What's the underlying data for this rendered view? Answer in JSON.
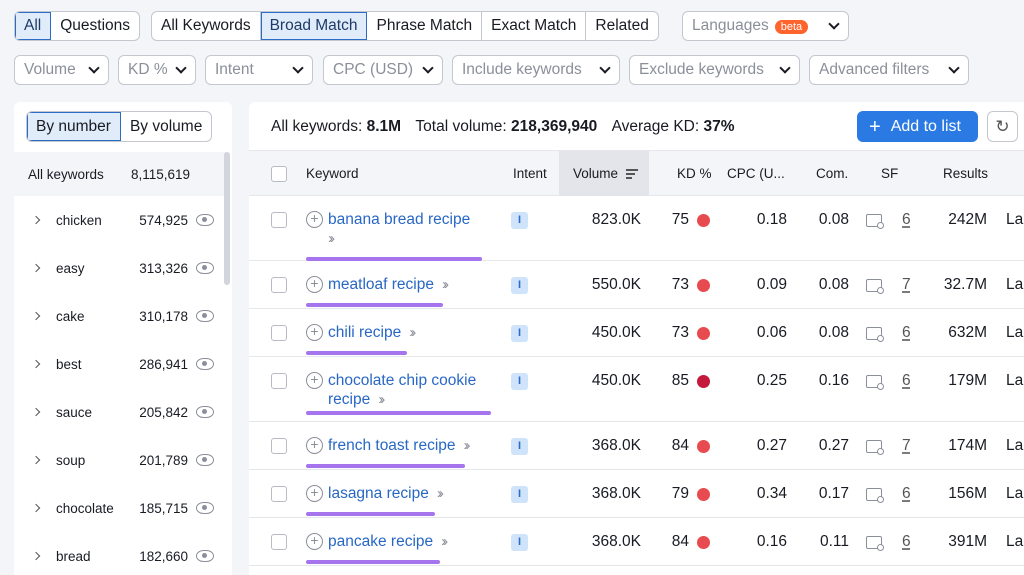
{
  "top_seg1": [
    "All",
    "Questions"
  ],
  "top_seg2": [
    "All Keywords",
    "Broad Match",
    "Phrase Match",
    "Exact Match",
    "Related"
  ],
  "languages": {
    "label": "Languages",
    "badge": "beta"
  },
  "filters": [
    "Volume",
    "KD %",
    "Intent",
    "CPC (USD)",
    "Include keywords",
    "Exclude keywords",
    "Advanced filters"
  ],
  "left": {
    "seg": [
      "By number",
      "By volume"
    ],
    "all_label": "All keywords",
    "all_count": "8,115,619",
    "groups": [
      {
        "name": "chicken",
        "count": "574,925"
      },
      {
        "name": "easy",
        "count": "313,326"
      },
      {
        "name": "cake",
        "count": "310,178"
      },
      {
        "name": "best",
        "count": "286,941"
      },
      {
        "name": "sauce",
        "count": "205,842"
      },
      {
        "name": "soup",
        "count": "201,789"
      },
      {
        "name": "chocolate",
        "count": "185,715"
      },
      {
        "name": "bread",
        "count": "182,660"
      }
    ]
  },
  "summary": {
    "all_label": "All keywords:",
    "all_value": "8.1M",
    "vol_label": "Total volume:",
    "vol_value": "218,369,940",
    "kd_label": "Average KD:",
    "kd_value": "37%"
  },
  "add_to_list": "Add to list",
  "refresh_glyph": "↻",
  "table": {
    "headers": {
      "keyword": "Keyword",
      "intent": "Intent",
      "volume": "Volume",
      "kd": "KD %",
      "cpc": "CPC (U...",
      "com": "Com.",
      "sf": "SF",
      "results": "Results"
    },
    "rows": [
      {
        "kw1": "banana bread recipe",
        "kw2": "",
        "intent": "I",
        "volume": "823.0K",
        "kd": "75",
        "kd_color": "#e84b4f",
        "cpc": "0.18",
        "com": "0.08",
        "sf": "6",
        "results": "242M",
        "last": "La"
      },
      {
        "kw1": "meatloaf recipe",
        "kw2": "",
        "intent": "I",
        "volume": "550.0K",
        "kd": "73",
        "kd_color": "#e84b4f",
        "cpc": "0.09",
        "com": "0.08",
        "sf": "7",
        "results": "32.7M",
        "last": "La"
      },
      {
        "kw1": "chili recipe",
        "kw2": "",
        "intent": "I",
        "volume": "450.0K",
        "kd": "73",
        "kd_color": "#e84b4f",
        "cpc": "0.06",
        "com": "0.08",
        "sf": "6",
        "results": "632M",
        "last": "La"
      },
      {
        "kw1": "chocolate chip cookie",
        "kw2": "recipe",
        "intent": "I",
        "volume": "450.0K",
        "kd": "85",
        "kd_color": "#c4193a",
        "cpc": "0.25",
        "com": "0.16",
        "sf": "6",
        "results": "179M",
        "last": "La"
      },
      {
        "kw1": "french toast recipe",
        "kw2": "",
        "intent": "I",
        "volume": "368.0K",
        "kd": "84",
        "kd_color": "#e84b4f",
        "cpc": "0.27",
        "com": "0.27",
        "sf": "7",
        "results": "174M",
        "last": "La"
      },
      {
        "kw1": "lasagna recipe",
        "kw2": "",
        "intent": "I",
        "volume": "368.0K",
        "kd": "79",
        "kd_color": "#e84b4f",
        "cpc": "0.34",
        "com": "0.17",
        "sf": "6",
        "results": "156M",
        "last": "La"
      },
      {
        "kw1": "pancake recipe",
        "kw2": "",
        "intent": "I",
        "volume": "368.0K",
        "kd": "84",
        "kd_color": "#e84b4f",
        "cpc": "0.16",
        "com": "0.11",
        "sf": "6",
        "results": "391M",
        "last": "La"
      }
    ]
  }
}
